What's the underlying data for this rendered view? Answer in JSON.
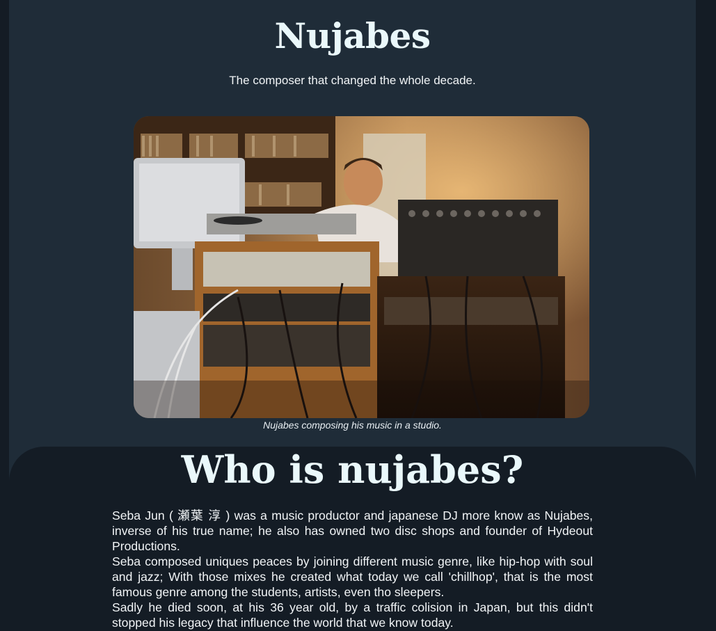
{
  "header": {
    "title": "Nujabes",
    "subtitle": "The composer that changed the whole decade."
  },
  "figure": {
    "image_alt": "Nujabes composing his music in a studio.",
    "caption": "Nujabes composing his music in a studio."
  },
  "about": {
    "heading": "Who is nujabes?",
    "paragraphs": [
      "Seba Jun ( 瀬葉 淳 ) was a music productor and japanese DJ more know as Nujabes, inverse of his true name; he also has owned two disc shops and founder of Hydeout Productions.",
      "Seba composed uniques peaces by joining different music genre, like hip-hop with soul and jazz; With those mixes he created what today we call 'chillhop', that is the most famous genre among the students, artists, even tho sleepers.",
      "Sadly he died soon, at his 36 year old, by a traffic colision in Japan, but this didn't stopped his legacy that influence the world that we know today."
    ]
  },
  "colors": {
    "page_background": "#141c25",
    "hero_background": "#1f2c38",
    "heading_text": "#eaf8fb",
    "body_text": "#f1f4f6"
  }
}
